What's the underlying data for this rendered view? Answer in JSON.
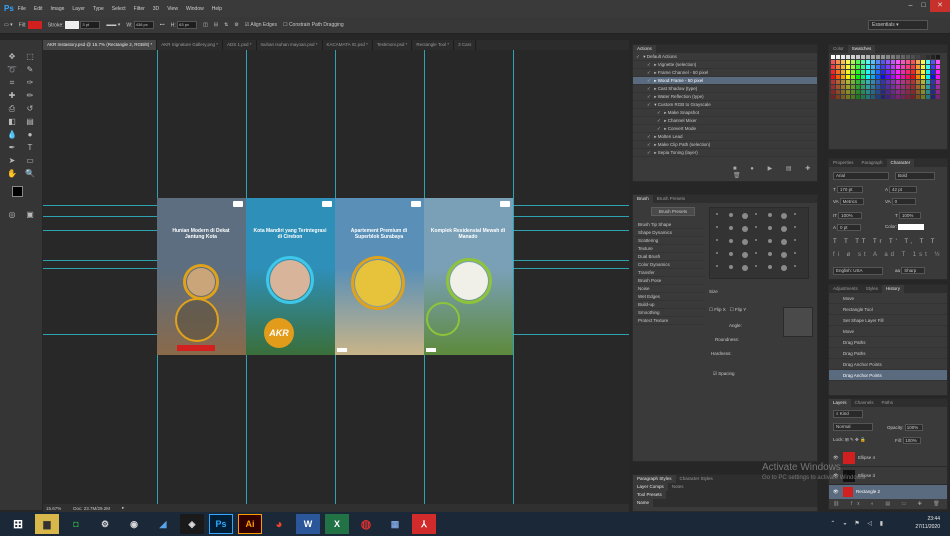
{
  "app": {
    "logo": "Ps"
  },
  "menu": [
    "File",
    "Edit",
    "Image",
    "Layer",
    "Type",
    "Select",
    "Filter",
    "3D",
    "View",
    "Window",
    "Help"
  ],
  "window_controls": [
    "–",
    "□",
    "✕"
  ],
  "options": {
    "fill_label": "Fill:",
    "stroke_label": "Stroke:",
    "stroke_size": "3 pt",
    "w_label": "W:",
    "w_value": "436 px",
    "h_label": "H:",
    "h_value": "63 px",
    "align_edges": "Align Edges",
    "constrain": "Constrain Path Dragging",
    "workspace": "Essentials",
    "fill_color": "#d21f1f"
  },
  "doc_tabs": [
    "AKR Instastory.psd @ 15.7% (Rectangle 2, RGB/8) *",
    "AKR Signature Gallery.png *",
    "ADS 1.psd *",
    "Isuhan Isuhan mayoan.psd *",
    "KACAMATA IG.psd *",
    "Testimoni.psd *",
    "Rectangle Tool *",
    "3 Cars"
  ],
  "cards": [
    {
      "headline": "Hunian Modern di Dekat Jantung Kota",
      "bg": "#5c6e80",
      "bg2": "#8a6a4a",
      "ring": "#e0a21a",
      "badge": ""
    },
    {
      "headline": "Kota Mandiri yang Terintegrasi di Cirebon",
      "bg": "#2e8fb8",
      "bg2": "#3a6f3a",
      "ring": "#3ec7e8",
      "badge": "AKR"
    },
    {
      "headline": "Apartement Premium di Superblok Surabaya",
      "bg": "#5a90b8",
      "bg2": "#c8b488",
      "ring": "#e0a21a",
      "badge": ""
    },
    {
      "headline": "Komplek Residensial Mewah di Manado",
      "bg": "#7aa0b8",
      "bg2": "#5d8a3c",
      "ring": "#8ec43a",
      "badge": ""
    }
  ],
  "status": {
    "zoom": "15.67%",
    "doc": "Doc: 23.7M/29.2M"
  },
  "actions": {
    "header": "Actions",
    "items": [
      "Default Actions",
      "Vignette (selection)",
      "Frame Channel - 50 pixel",
      "Wood Frame - 50 pixel",
      "Cast Shadow (type)",
      "Water Reflection (type)",
      "Custom RGB to Grayscale",
      "Make Snapshot",
      "Channel Mixer",
      "Convert Mode",
      "Molten Lead",
      "Make Clip Path (selection)",
      "Sepia Toning (layer)"
    ]
  },
  "brush": {
    "tabs": [
      "Brush",
      "Brush Presets"
    ],
    "preset_button": "Brush Presets",
    "items": [
      "Brush Tip Shape",
      "Shape Dynamics",
      "Scattering",
      "Texture",
      "Dual Brush",
      "Color Dynamics",
      "Transfer",
      "Brush Pose",
      "Noise",
      "Wet Edges",
      "Build-up",
      "Smoothing",
      "Protect Texture"
    ],
    "size": "Size",
    "flip_x": "Flip X",
    "flip_y": "Flip Y",
    "angle": "Angle:",
    "roundness": "Roundness:",
    "hardness": "Hardness:",
    "spacing": "Spacing"
  },
  "swatches": {
    "tabs": [
      "Color",
      "Swatches"
    ]
  },
  "character": {
    "tabs": [
      "Properties",
      "Paragraph",
      "Character"
    ],
    "font": "Arial",
    "style": "Bold",
    "size": "170 pt",
    "leading": "42 pt",
    "kerning": "Metrics",
    "tracking": "0",
    "vscale": "100%",
    "hscale": "100%",
    "baseline": "0 pt",
    "color_label": "Color:",
    "language": "English: USA",
    "aa": "Sharp"
  },
  "history": {
    "tabs": [
      "Adjustments",
      "Styles",
      "History"
    ],
    "items": [
      "Move",
      "Rectangle Tool",
      "Set Shape Layer Fill",
      "Move",
      "Drag Paths",
      "Drag Paths",
      "Drag Anchor Points",
      "Drag Anchor Points"
    ]
  },
  "layers": {
    "tabs": [
      "Layers",
      "Channels",
      "Paths"
    ],
    "kind": "Kind",
    "blend": "Normal",
    "opacity_label": "Opacity:",
    "opacity": "100%",
    "lock_label": "Lock:",
    "fill_label": "Fill:",
    "fill": "100%",
    "items": [
      "Ellipse 4",
      "Ellipse 3",
      "Rectangle 2"
    ]
  },
  "bottom_tabs": {
    "row1": [
      "Paragraph Styles",
      "Character Styles"
    ],
    "row2": [
      "Layer Comps",
      "Notes"
    ],
    "row3": [
      "Tool Presets"
    ],
    "row4": [
      "Name"
    ]
  },
  "watermark": {
    "title": "Activate Windows",
    "sub": "Go to PC settings to activate Windows."
  },
  "clock": {
    "time": "23:44",
    "date": "27/11/2020"
  }
}
